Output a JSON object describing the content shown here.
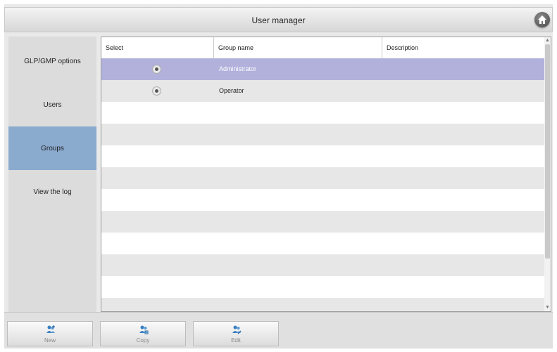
{
  "window": {
    "title": "User manager",
    "home_icon": "home-icon"
  },
  "sidebar": {
    "items": [
      {
        "label": "GLP/GMP options",
        "active": false
      },
      {
        "label": "Users",
        "active": false
      },
      {
        "label": "Groups",
        "active": true
      },
      {
        "label": "View the log",
        "active": false
      }
    ]
  },
  "table": {
    "columns": [
      "Select",
      "Group name",
      "Description"
    ],
    "rows": [
      {
        "selected": true,
        "group_name": "Administrator",
        "description": ""
      },
      {
        "selected": false,
        "group_name": "Operator",
        "description": ""
      }
    ]
  },
  "toolbar": {
    "buttons": [
      {
        "label": "New",
        "icon": "new-group-icon"
      },
      {
        "label": "Copy",
        "icon": "copy-group-icon"
      },
      {
        "label": "Edit",
        "icon": "edit-group-icon"
      }
    ]
  },
  "colors": {
    "sidebar_active": "#8aaace",
    "row_selected": "#b1b1dc",
    "row_alt": "#e7e7e7"
  }
}
